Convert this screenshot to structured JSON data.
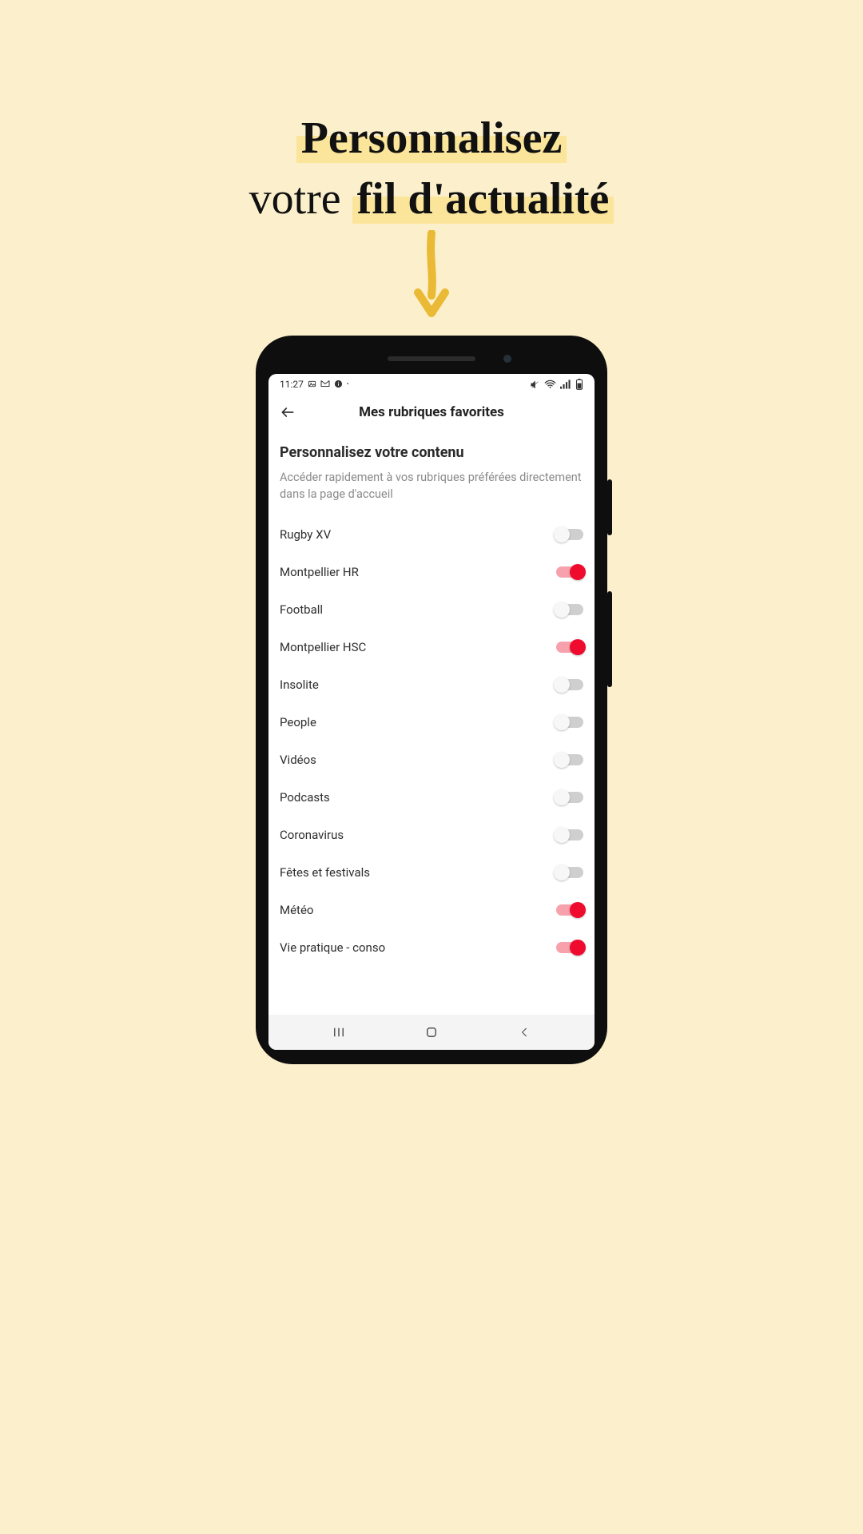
{
  "headline": {
    "word1": "Personnalisez",
    "word2": "votre",
    "word3": "fil d'actualité"
  },
  "statusbar": {
    "time": "11:27"
  },
  "appbar": {
    "title": "Mes rubriques favorites"
  },
  "section": {
    "title": "Personnalisez votre contenu",
    "subtitle": "Accéder rapidement à vos rubriques préférées directement dans la page d'accueil"
  },
  "rows": [
    {
      "label": "Rugby XV",
      "on": false
    },
    {
      "label": "Montpellier HR",
      "on": true
    },
    {
      "label": "Football",
      "on": false
    },
    {
      "label": "Montpellier HSC",
      "on": true
    },
    {
      "label": "Insolite",
      "on": false
    },
    {
      "label": "People",
      "on": false
    },
    {
      "label": "Vidéos",
      "on": false
    },
    {
      "label": "Podcasts",
      "on": false
    },
    {
      "label": "Coronavirus",
      "on": false
    },
    {
      "label": "Fêtes et festivals",
      "on": false
    },
    {
      "label": "Météo",
      "on": true
    },
    {
      "label": "Vie pratique - conso",
      "on": true
    }
  ],
  "colors": {
    "toggle_on_knob": "#ef0b2e",
    "toggle_on_track": "#f7a1ad",
    "toggle_off_knob": "#f7f7f7",
    "toggle_off_track": "#cfcfcf",
    "page_bg": "#fcf0cc",
    "highlight": "#fbe59a",
    "arrow": "#eab935"
  }
}
